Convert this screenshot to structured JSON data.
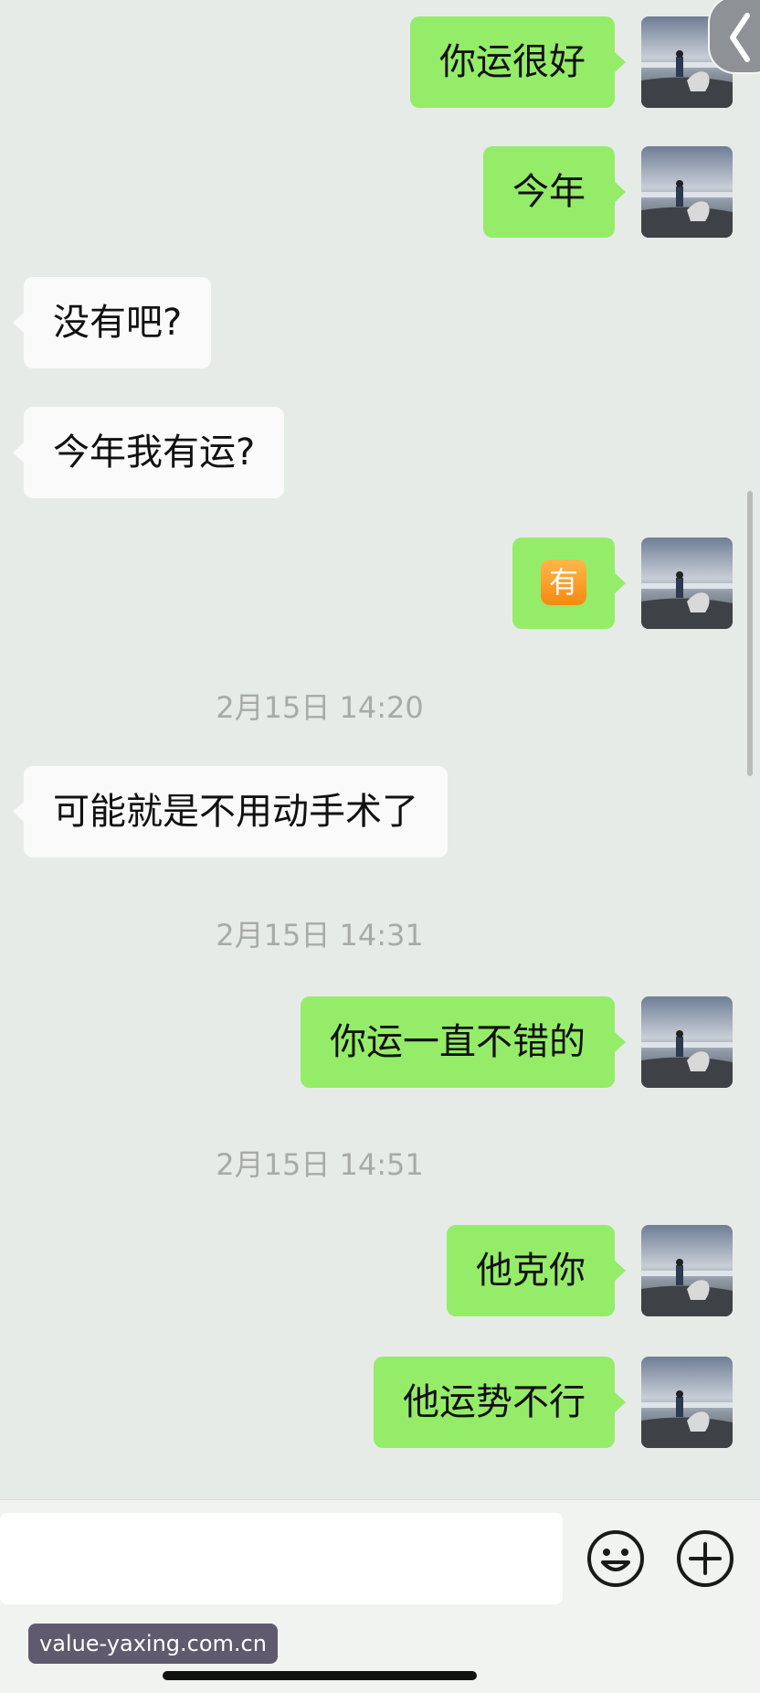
{
  "messages": [
    {
      "side": "out",
      "text": "你运很好"
    },
    {
      "side": "out",
      "text": "今年"
    },
    {
      "side": "in",
      "text": "没有吧?"
    },
    {
      "side": "in",
      "text": "今年我有运?"
    },
    {
      "side": "out",
      "emoji": "有"
    },
    {
      "time": "2月15日 14:20"
    },
    {
      "side": "in",
      "text": "可能就是不用动手术了"
    },
    {
      "time": "2月15日 14:31"
    },
    {
      "side": "out",
      "text": "你运一直不错的"
    },
    {
      "time": "2月15日 14:51"
    },
    {
      "side": "out",
      "text": "他克你"
    },
    {
      "side": "out",
      "text": "他运势不行"
    }
  ],
  "input": {
    "placeholder": ""
  },
  "icons": {
    "emoji_button": "smiley-icon",
    "more_button": "plus-circle-icon",
    "back": "chevron-left-icon"
  },
  "watermark": "value-yaxing.com.cn",
  "colors": {
    "outgoing_bubble": "#95ec69",
    "incoming_bubble": "#fafafa",
    "chat_background": "#e7ebe7"
  }
}
